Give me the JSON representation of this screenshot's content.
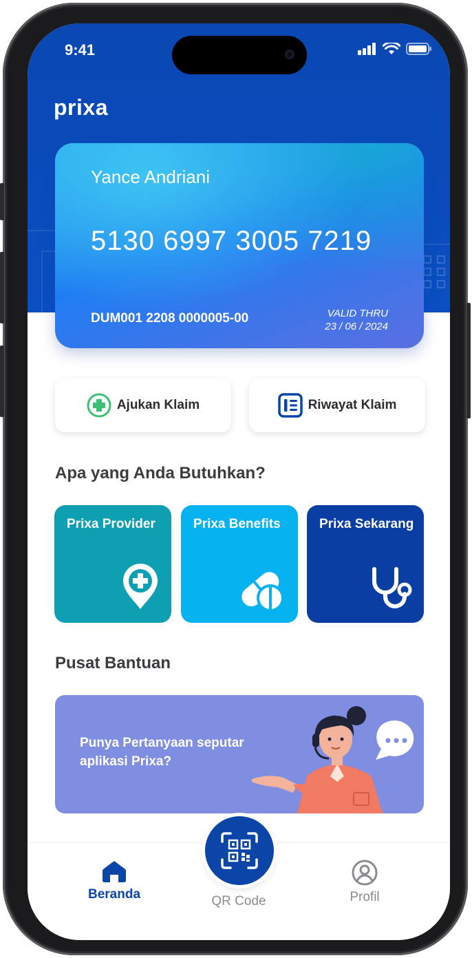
{
  "status_bar": {
    "time": "9:41"
  },
  "brand": {
    "logo": "prixa"
  },
  "card": {
    "holder_name": "Yance Andriani",
    "number": "5130  6997  3005 7219",
    "policy_number": "DUM001 2208 0000005-00",
    "valid_label": "VALID THRU",
    "valid_date": "23 / 06 / 2024"
  },
  "actions": {
    "claim_label": "Ajukan Klaim",
    "history_label": "Riwayat Klaim"
  },
  "needs": {
    "title": "Apa yang Anda Butuhkan?",
    "tiles": [
      {
        "label": "Prixa Provider",
        "icon": "map-pin-plus-icon",
        "color": "#0e9fb2"
      },
      {
        "label": "Prixa Benefits",
        "icon": "pills-icon",
        "color": "#06b2f0"
      },
      {
        "label": "Prixa Sekarang",
        "icon": "stethoscope-icon",
        "color": "#0b3ea3"
      }
    ]
  },
  "help": {
    "title": "Pusat Bantuan",
    "banner_text": "Punya Pertanyaan seputar aplikasi Prixa?"
  },
  "tabbar": {
    "home_label": "Beranda",
    "qr_label": "QR Code",
    "profile_label": "Profil"
  },
  "colors": {
    "primary": "#0a47b3",
    "active_tab": "#0b45a8",
    "inactive_tab": "#8a8c92",
    "claim_icon": "#3bbf72"
  }
}
